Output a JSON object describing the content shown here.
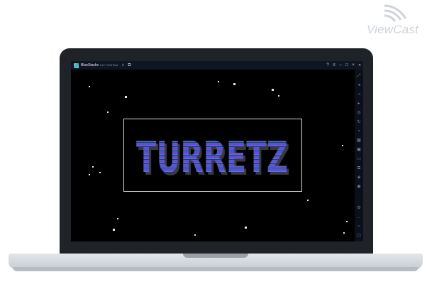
{
  "watermark": {
    "brand": "ViewCast"
  },
  "emulator": {
    "app_name": "BlueStacks",
    "version_text": "5.8.7.1038 Beta",
    "titlebar_icons": [
      "home-icon",
      "multi-instance-icon"
    ],
    "window_controls": [
      "help-icon",
      "menu-icon",
      "minimize-icon",
      "maximize-icon",
      "close-icon",
      "collapse-icon"
    ],
    "sidebar_icons": [
      "fullscreen-icon",
      "volume-up-icon",
      "volume-down-icon",
      "video-icon",
      "screenshot-icon",
      "rotate-icon",
      "camera-icon",
      "macro-icon",
      "apk-icon",
      "folder-icon",
      "copy-icon",
      "eco-icon",
      "settings-icon",
      "back-icon",
      "home-icon",
      "recent-apps-icon"
    ]
  },
  "game": {
    "title": "TURRETZ"
  }
}
